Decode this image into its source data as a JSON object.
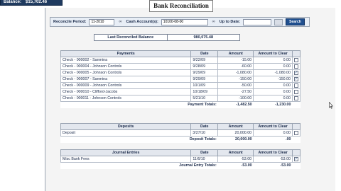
{
  "header": {
    "balance_label": "Balance:",
    "balance_value": "$15,702.46",
    "title": "Bank Reconciliation"
  },
  "filters": {
    "period_label": "Reconcile Period:",
    "period_value": "11-2010",
    "accounts_label": "Cash Account(s):",
    "accounts_value": "10100-08-00",
    "date_label": "Up to Date:",
    "date_value": "",
    "search_label": "Search"
  },
  "last_reconciled": {
    "label": "Last Reconciled Balance",
    "value": "980,075.48"
  },
  "payments": {
    "headers": [
      "Payments",
      "Date",
      "Amount",
      "Amount to Clear"
    ],
    "rows": [
      {
        "desc": "Check - 000002 - Sanmina",
        "date": "9/22/09",
        "amount": "-15.00",
        "clear": "0.00",
        "checked": false
      },
      {
        "desc": "Check - 000004 - Johnson Controls",
        "date": "9/28/09",
        "amount": "-60.00",
        "clear": "0.00",
        "checked": false
      },
      {
        "desc": "Check - 000005 - Johnson Controls",
        "date": "9/29/09",
        "amount": "-1,080.00",
        "clear": "-1,080.00",
        "checked": true
      },
      {
        "desc": "Check - 000007 - Sanmina",
        "date": "9/29/09",
        "amount": "-150.00",
        "clear": "-150.00",
        "checked": true
      },
      {
        "desc": "Check - 000009 - Johnson Controls",
        "date": "10/1/09",
        "amount": "-50.00",
        "clear": "0.00",
        "checked": false
      },
      {
        "desc": "Check - 000010 - Clifford-Jacobs",
        "date": "10/18/09",
        "amount": "-27.50",
        "clear": "0.00",
        "checked": false
      },
      {
        "desc": "Check - 000011 - Johnson Controls",
        "date": "5/21/10",
        "amount": "-100.00",
        "clear": "0.00",
        "checked": false
      }
    ],
    "total_label": "Payment Totals:",
    "total_amount": "-1,482.50",
    "total_clear": "-1,230.00"
  },
  "deposits": {
    "headers": [
      "Deposits",
      "Date",
      "Amount",
      "Amount to Clear"
    ],
    "rows": [
      {
        "desc": "Deposit",
        "date": "3/27/10",
        "amount": "20,000.00",
        "clear": "0.00",
        "checked": false
      }
    ],
    "total_label": "Deposit Totals:",
    "total_amount": "20,000.00",
    "total_clear": ".00"
  },
  "journal": {
    "headers": [
      "Journal Entries",
      "Date",
      "Amount",
      "Amount to Clear"
    ],
    "rows": [
      {
        "desc": "Misc Bank Fees",
        "date": "11/6/10",
        "amount": "-53.00",
        "clear": "-53.00",
        "checked": true
      }
    ],
    "total_label": "Journal Entry Totals:",
    "total_amount": "-53.00",
    "total_clear": "-53.00"
  },
  "icons": {
    "lookup": "binoculars-icon",
    "calendar": "calendar-icon",
    "check": "checkmark-icon",
    "cursor": "mouse-pointer-icon"
  },
  "colors": {
    "accent": "#1f4f8f",
    "header_bg": "#e3e7ee",
    "balance_bg": "#1f3a5f"
  }
}
